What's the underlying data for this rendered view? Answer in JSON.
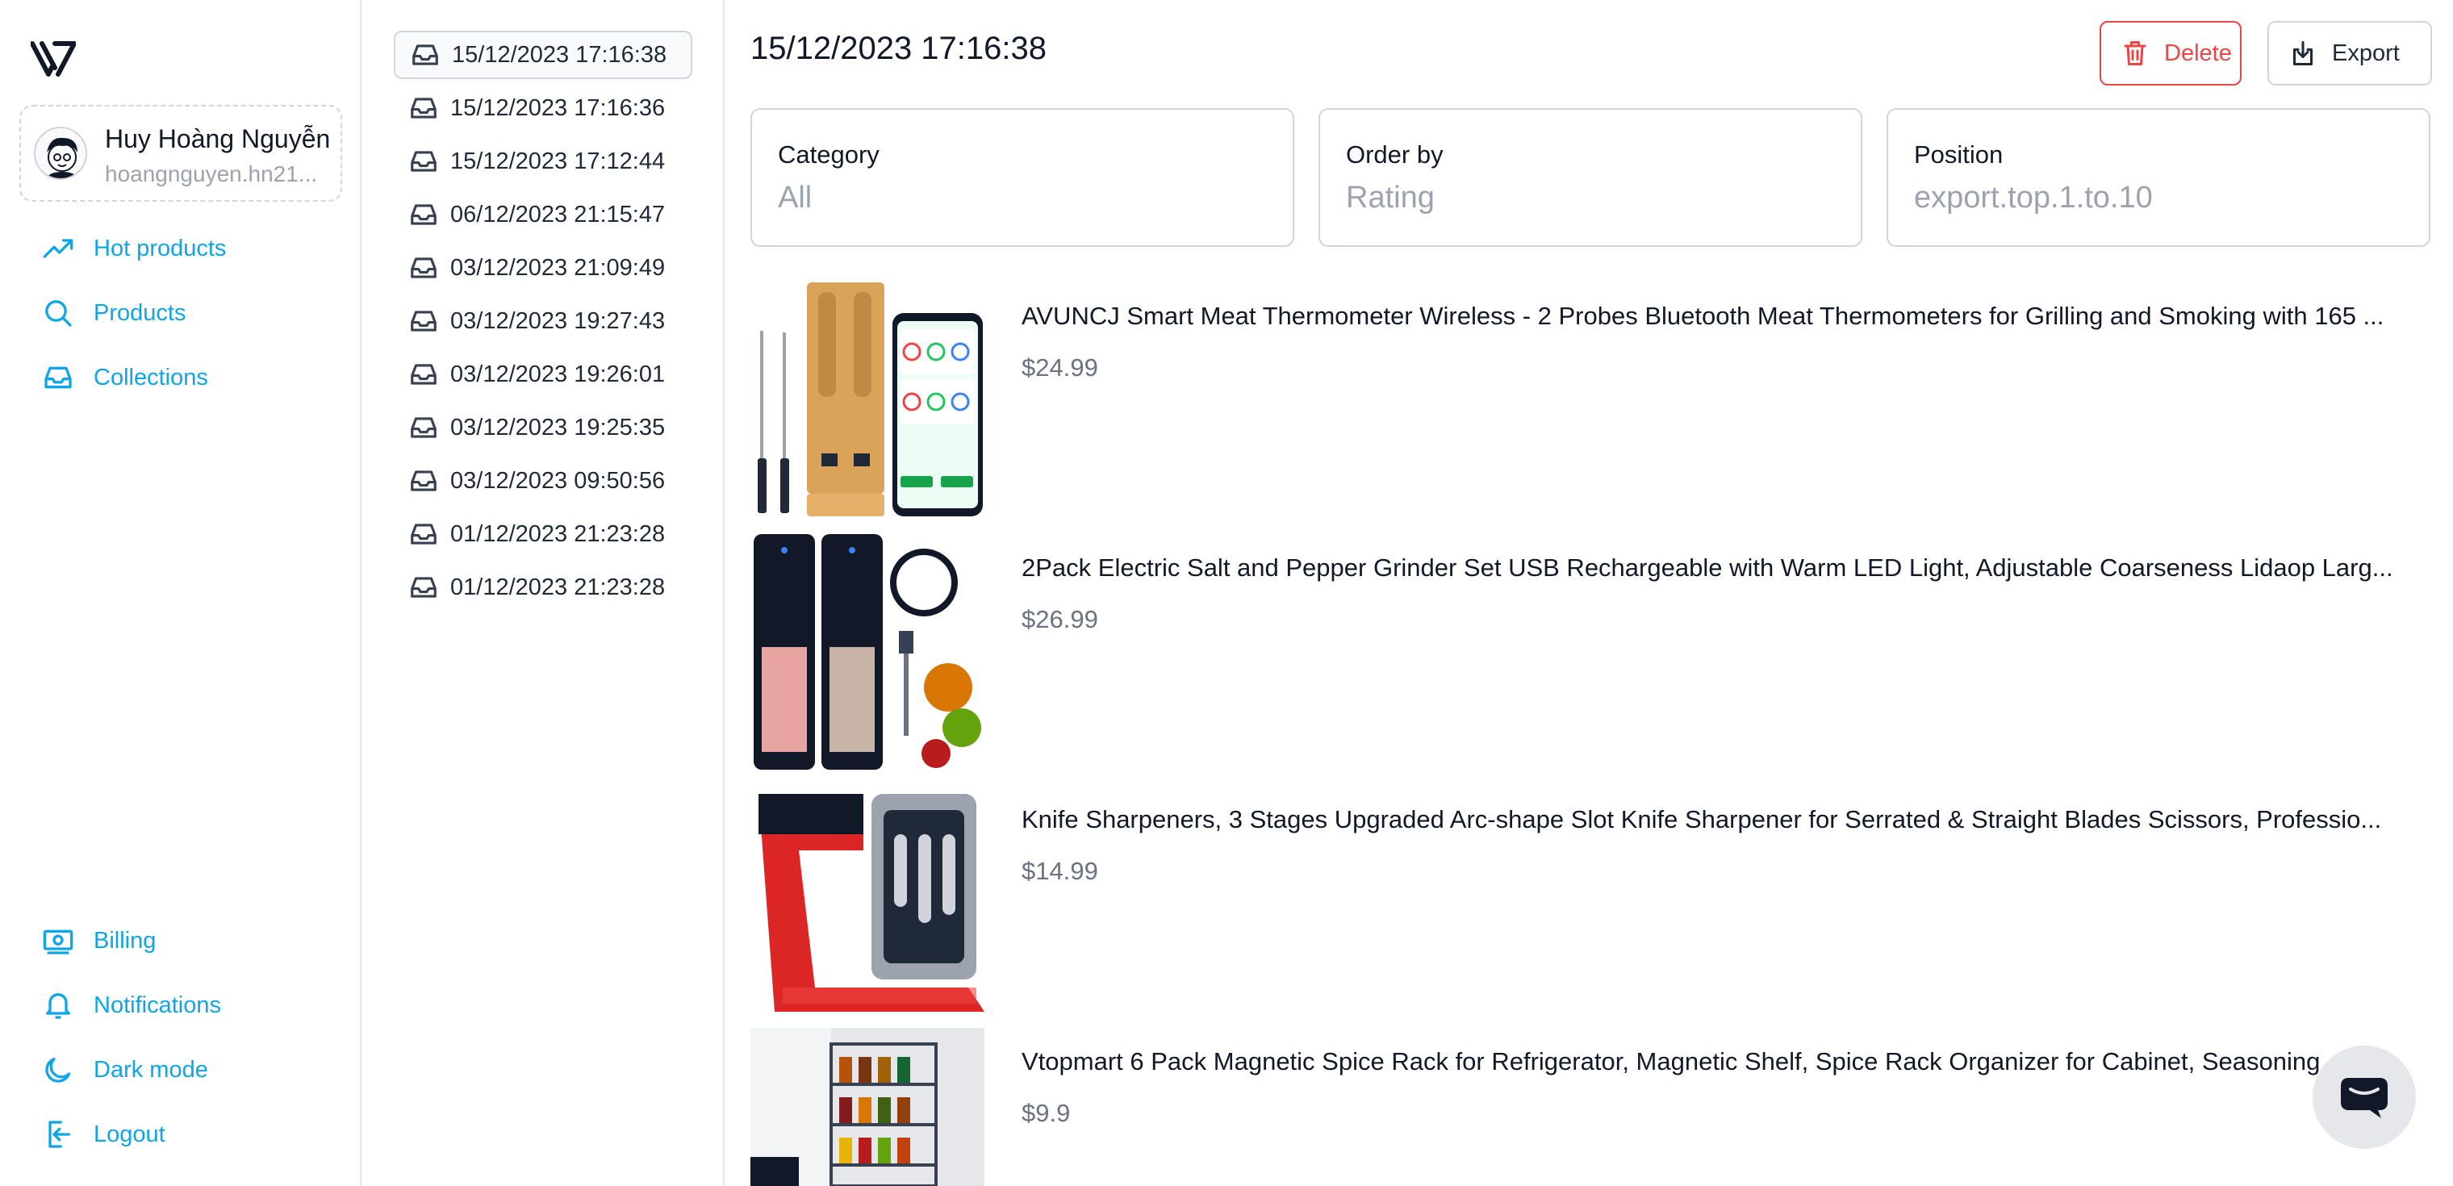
{
  "user": {
    "name": "Huy Hoàng Nguyễn",
    "email": "hoangnguyen.hn21..."
  },
  "nav": {
    "top": [
      {
        "label": "Hot products",
        "icon": "trending-up-icon"
      },
      {
        "label": "Products",
        "icon": "search-icon"
      },
      {
        "label": "Collections",
        "icon": "inbox-icon"
      }
    ],
    "bottom": [
      {
        "label": "Billing",
        "icon": "banknote-icon"
      },
      {
        "label": "Notifications",
        "icon": "bell-icon"
      },
      {
        "label": "Dark mode",
        "icon": "moon-icon"
      },
      {
        "label": "Logout",
        "icon": "logout-icon"
      }
    ]
  },
  "history": [
    "15/12/2023 17:16:38",
    "15/12/2023 17:16:36",
    "15/12/2023 17:12:44",
    "06/12/2023 21:15:47",
    "03/12/2023 21:09:49",
    "03/12/2023 19:27:43",
    "03/12/2023 19:26:01",
    "03/12/2023 19:25:35",
    "03/12/2023 09:50:56",
    "01/12/2023 21:23:28",
    "01/12/2023 21:23:28"
  ],
  "main": {
    "title": "15/12/2023 17:16:38",
    "delete_label": "Delete",
    "export_label": "Export",
    "filters": [
      {
        "label": "Category",
        "value": "All"
      },
      {
        "label": "Order by",
        "value": "Rating"
      },
      {
        "label": "Position",
        "value": "export.top.1.to.10"
      }
    ]
  },
  "products": [
    {
      "title": "AVUNCJ Smart Meat Thermometer Wireless - 2 Probes Bluetooth Meat Thermometers for Grilling and Smoking with 165 ...",
      "price": "$24.99"
    },
    {
      "title": "2Pack Electric Salt and Pepper Grinder Set USB Rechargeable with Warm LED Light, Adjustable Coarseness Lidaop Larg...",
      "price": "$26.99"
    },
    {
      "title": "Knife Sharpeners, 3 Stages Upgraded Arc-shape Slot Knife Sharpener for Serrated & Straight Blades Scissors, Professio...",
      "price": "$14.99"
    },
    {
      "title": "Vtopmart 6 Pack Magnetic Spice Rack for Refrigerator, Magnetic Shelf, Spice Rack Organizer for Cabinet, Seasoning ...",
      "price": "$9.9"
    }
  ],
  "colors": {
    "accent": "#0ea5e9",
    "danger": "#ef4444",
    "border": "#d1d5db",
    "muted": "#9ca3af"
  }
}
